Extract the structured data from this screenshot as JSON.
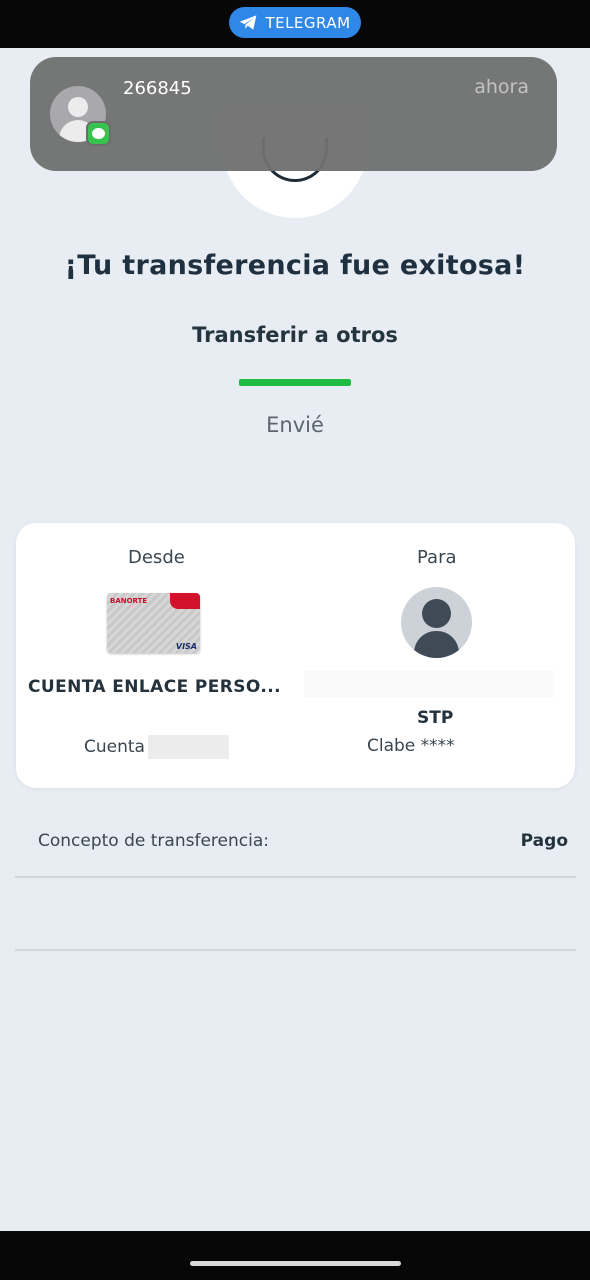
{
  "status_bar": {
    "telegram_label": "TELEGRAM"
  },
  "notification": {
    "title": "266845",
    "time": "ahora"
  },
  "success": {
    "title": "¡Tu transferencia fue exitosa!"
  },
  "tab": {
    "label": "Transferir a otros",
    "subtitle": "Envié"
  },
  "transfer": {
    "from_label": "Desde",
    "to_label": "Para",
    "from_account_name": "CUENTA ENLACE PERSO...",
    "from_account_label": "Cuenta",
    "to_bank": "STP",
    "to_account_label": "Clabe ****",
    "card_brand": "VISA",
    "card_issuer": "BANORTE"
  },
  "concept": {
    "label": "Concepto de transferencia:",
    "value": "Pago"
  },
  "colors": {
    "accent_green": "#1fbb45",
    "background": "#e8ecf3",
    "telegram_blue": "#2f87e8"
  }
}
